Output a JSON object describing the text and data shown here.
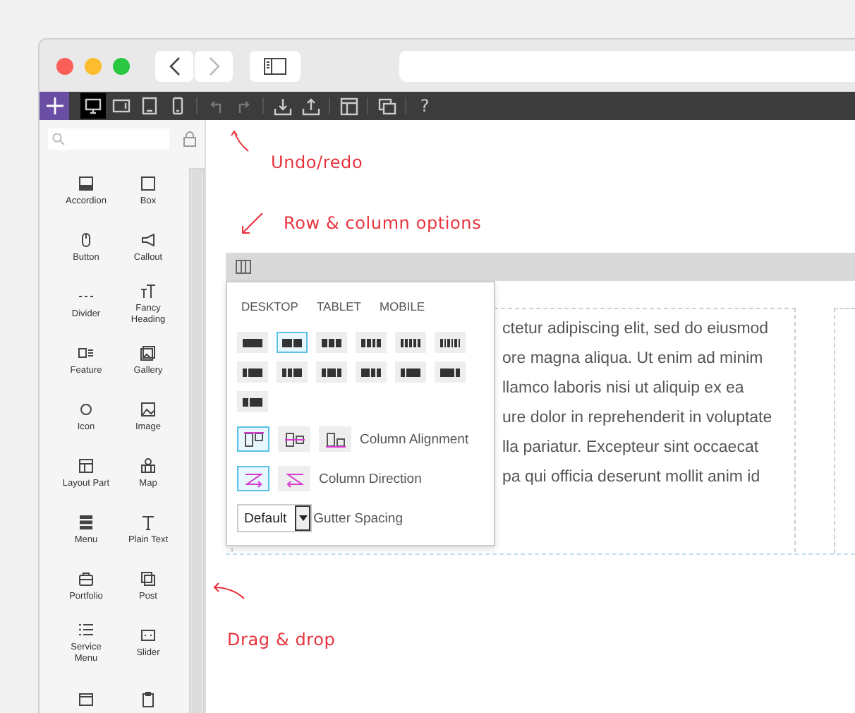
{
  "toolbar": {
    "devices": [
      {
        "kind": "desktop",
        "selected": true
      },
      {
        "kind": "tablet-landscape",
        "selected": false
      },
      {
        "kind": "tablet",
        "selected": false
      },
      {
        "kind": "mobile",
        "selected": false
      }
    ],
    "help_label": "?"
  },
  "sidebar": {
    "items": [
      {
        "label": "Accordion",
        "kind": "accordion"
      },
      {
        "label": "Box",
        "kind": "box"
      },
      {
        "label": "Button",
        "kind": "button"
      },
      {
        "label": "Callout",
        "kind": "callout"
      },
      {
        "label": "Divider",
        "kind": "divider"
      },
      {
        "label": "Fancy Heading",
        "kind": "heading"
      },
      {
        "label": "Feature",
        "kind": "feature"
      },
      {
        "label": "Gallery",
        "kind": "gallery"
      },
      {
        "label": "Icon",
        "kind": "icon"
      },
      {
        "label": "Image",
        "kind": "image"
      },
      {
        "label": "Layout Part",
        "kind": "layout"
      },
      {
        "label": "Map",
        "kind": "map"
      },
      {
        "label": "Menu",
        "kind": "menu"
      },
      {
        "label": "Plain Text",
        "kind": "text"
      },
      {
        "label": "Portfolio",
        "kind": "portfolio"
      },
      {
        "label": "Post",
        "kind": "post"
      },
      {
        "label": "Service Menu",
        "kind": "list"
      },
      {
        "label": "Slider",
        "kind": "slider"
      }
    ]
  },
  "annotations": [
    {
      "text": "Undo/redo"
    },
    {
      "text": "Row & column options"
    },
    {
      "text": "Drag & drop"
    }
  ],
  "row_options": {
    "tabs": [
      {
        "label": "DESKTOP"
      },
      {
        "label": "TABLET"
      },
      {
        "label": "MOBILE"
      }
    ],
    "layouts": [
      {
        "selected": false
      },
      {
        "selected": true
      },
      {
        "selected": false
      },
      {
        "selected": false
      },
      {
        "selected": false
      },
      {
        "selected": false
      },
      {
        "selected": false
      },
      {
        "selected": false
      },
      {
        "selected": false
      },
      {
        "selected": false
      },
      {
        "selected": false
      },
      {
        "selected": false
      },
      {
        "selected": false
      }
    ],
    "alignment": {
      "label": "Column Alignment",
      "options": [
        {
          "kind": "top",
          "selected": true
        },
        {
          "kind": "middle",
          "selected": false
        },
        {
          "kind": "bottom",
          "selected": false
        }
      ]
    },
    "direction": {
      "label": "Column Direction",
      "options": [
        {
          "kind": "forward",
          "selected": true
        },
        {
          "kind": "reverse",
          "selected": false
        }
      ]
    },
    "gutter": {
      "value": "Default",
      "label": "Gutter Spacing"
    }
  },
  "content": {
    "lines": [
      "ctetur adipiscing elit, sed do eiusmod",
      "ore magna aliqua. Ut enim ad minim",
      "llamco laboris nisi ut aliquip ex ea",
      "ure dolor in reprehenderit in voluptate",
      "lla pariatur. Excepteur sint occaecat",
      "pa qui officia deserunt mollit anim id"
    ]
  }
}
